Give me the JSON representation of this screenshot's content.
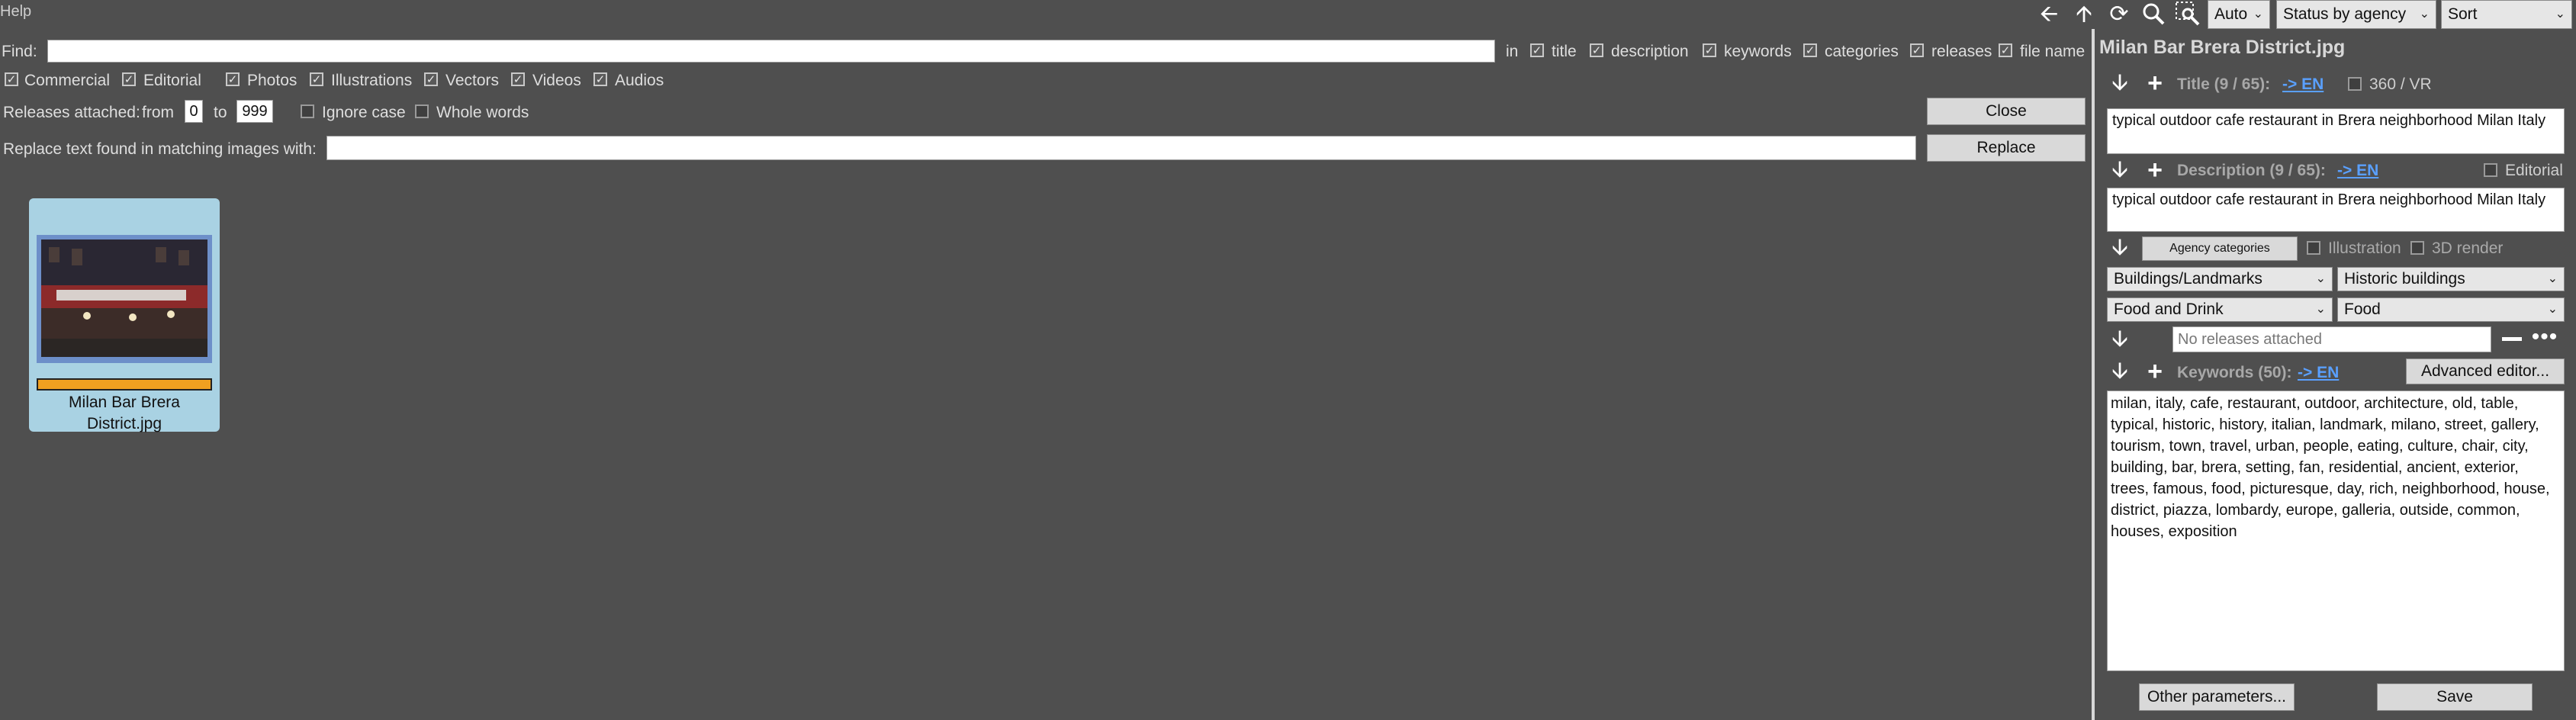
{
  "menu": {
    "help": "Help"
  },
  "toolbar": {
    "mode_select": "Auto",
    "status_select": "Status by agency",
    "sort_select": "Sort"
  },
  "find": {
    "label": "Find:",
    "value": "",
    "in_label": "in",
    "fields": [
      {
        "label": "title",
        "checked": true
      },
      {
        "label": "description",
        "checked": true
      },
      {
        "label": "keywords",
        "checked": true
      },
      {
        "label": "categories",
        "checked": true
      },
      {
        "label": "releases",
        "checked": true
      },
      {
        "label": "file name",
        "checked": true
      }
    ],
    "types": [
      {
        "label": "Commercial",
        "checked": true
      },
      {
        "label": "Editorial",
        "checked": true
      },
      {
        "label": "Photos",
        "checked": true
      },
      {
        "label": "Illustrations",
        "checked": true
      },
      {
        "label": "Vectors",
        "checked": true
      },
      {
        "label": "Videos",
        "checked": true
      },
      {
        "label": "Audios",
        "checked": true
      }
    ],
    "releases_label": "Releases attached:",
    "from_label": "from",
    "from_value": "0",
    "to_label": "to",
    "to_value": "999",
    "ignore_case": "Ignore case",
    "whole_words": "Whole words",
    "close_label": "Close",
    "replace_label": "Replace text found in matching images with:",
    "replace_value": "",
    "replace_button": "Replace"
  },
  "thumbnail": {
    "filename_line1": "Milan Bar Brera",
    "filename_line2": "District.jpg",
    "status_color": "#f0a020"
  },
  "panel": {
    "filename": "Milan Bar Brera District.jpg",
    "title_label": "Title (9 / 65):",
    "title_lang": "-> EN",
    "vr_label": "360 / VR",
    "title_value": "typical outdoor cafe restaurant in Brera neighborhood Milan Italy",
    "description_label": "Description (9 / 65):",
    "description_lang": "-> EN",
    "editorial_label": "Editorial",
    "description_value": "typical outdoor cafe restaurant in Brera neighborhood Milan Italy",
    "agency_categories_button": "Agency categories",
    "illustration_label": "Illustration",
    "render_label": "3D render",
    "categories": [
      "Buildings/Landmarks",
      "Historic buildings",
      "Food and Drink",
      "Food"
    ],
    "releases_placeholder": "No releases attached",
    "keywords_label": "Keywords (50):",
    "keywords_lang": "-> EN",
    "advanced_editor_button": "Advanced editor...",
    "keywords_value": "milan, italy, cafe, restaurant, outdoor, architecture, old, table, typical, historic, history, italian, landmark, milano, street, gallery, tourism, town, travel, urban, people, eating, culture, chair, city, building, bar, brera, setting, fan, residential, ancient, exterior, trees, famous, food, picturesque, day, rich, neighborhood, house, district, piazza, lombardy, europe, galleria, outside, common, houses, exposition",
    "other_parameters_button": "Other parameters...",
    "save_button": "Save"
  },
  "colors": {
    "background": "#4f4f4f",
    "thumb_bg": "#a9d2e3",
    "link": "#5aa0ff"
  }
}
